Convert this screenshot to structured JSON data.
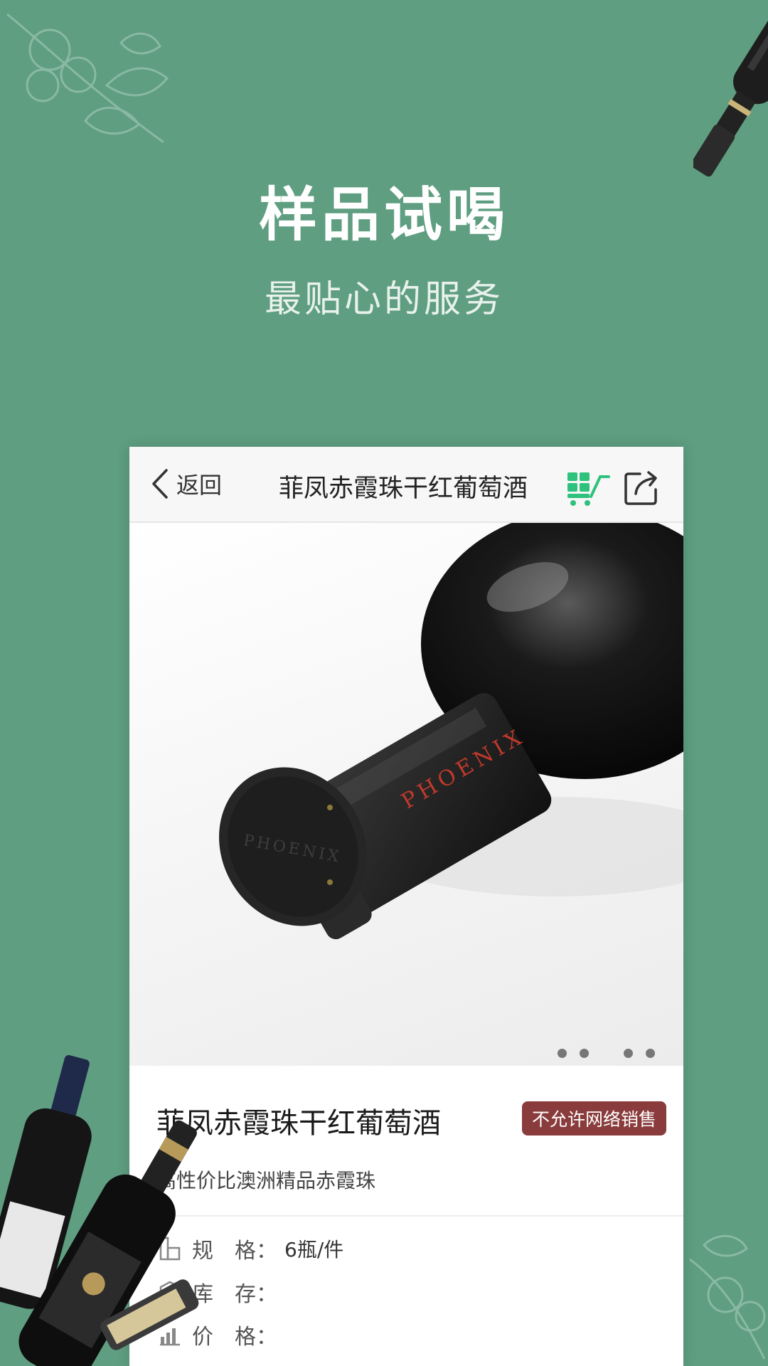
{
  "hero": {
    "title": "样品试喝",
    "subtitle": "最贴心的服务"
  },
  "navbar": {
    "back_label": "返回",
    "title": "菲凤赤霞珠干红葡萄酒",
    "cart_icon": "cart-grid-icon",
    "share_icon": "share-icon"
  },
  "gallery": {
    "bottle_cap_text": "PHOENIX",
    "bottle_neck_text": "PHOENIX",
    "dot_count": 5,
    "active_dot": 2
  },
  "product": {
    "title": "菲凤赤霞珠干红葡萄酒",
    "badge": "不允许网络销售",
    "description": "高性价比澳洲精品赤霞珠"
  },
  "specs": [
    {
      "label": "规　格：",
      "value": "6瓶/件",
      "icon": "spec-icon"
    },
    {
      "label": "库　存：",
      "value": "",
      "icon": "stock-icon"
    },
    {
      "label": "价　格：",
      "value": "",
      "icon": "price-icon"
    }
  ],
  "colors": {
    "background": "#5f9e80",
    "cart_accent": "#2fc27c",
    "badge": "#8a3c3c"
  }
}
